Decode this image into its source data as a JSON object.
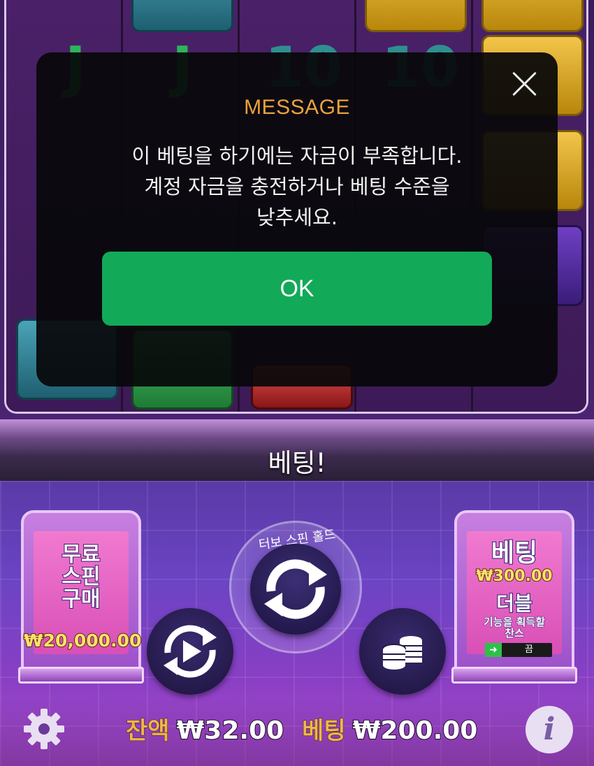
{
  "modal": {
    "title": "MESSAGE",
    "message_lines": [
      "이 베팅을 하기에는 자금이 부족합니다.",
      "계정 자금을 충전하거나 베팅 수준을",
      "낮추세요."
    ],
    "ok_label": "OK"
  },
  "bet_banner": "베팅!",
  "buy_feature": {
    "label_lines": [
      "무료",
      "스핀",
      "구매"
    ],
    "price": "₩20,000.00"
  },
  "double_chance": {
    "title": "베팅",
    "price": "₩300.00",
    "subtitle": "더블",
    "desc_lines": [
      "기능을 획득할",
      "찬스"
    ],
    "toggle_state": "끔"
  },
  "spin": {
    "turbo_label": "터보 스핀 홀드"
  },
  "footer": {
    "balance_label": "잔액",
    "balance_value": "₩32.00",
    "bet_label": "베팅",
    "bet_value": "₩200.00"
  },
  "icons": {
    "close": "close-icon",
    "spin": "spin-arrows-icon",
    "autoplay": "autoplay-icon",
    "coins": "coins-stack-icon",
    "settings": "gear-icon",
    "info": "info-icon"
  },
  "colors": {
    "modal_title": "#e9a23b",
    "ok_button": "#12a959",
    "balance_label": "#f0b64a",
    "price_gold": "#ffe36a"
  }
}
